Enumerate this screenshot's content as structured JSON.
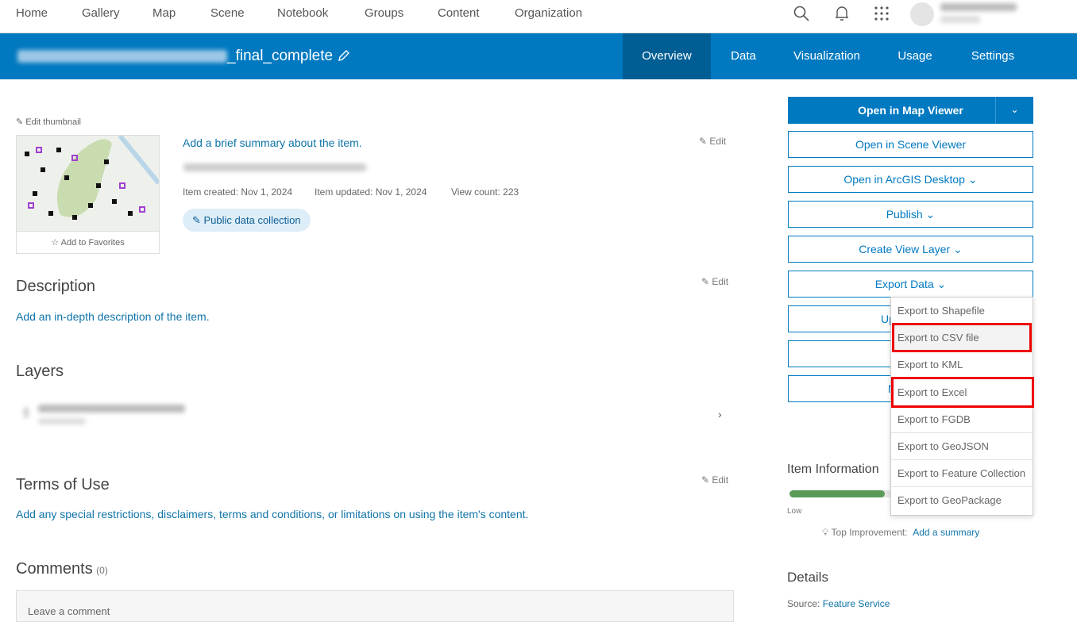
{
  "topnav": {
    "items": [
      "Home",
      "Gallery",
      "Map",
      "Scene",
      "Notebook",
      "Groups",
      "Content",
      "Organization"
    ]
  },
  "header": {
    "title_visible": "_final_complete",
    "tabs": [
      "Overview",
      "Data",
      "Visualization",
      "Usage",
      "Settings"
    ],
    "active_tab": "Overview"
  },
  "thumbnail": {
    "edit_label": "Edit thumbnail",
    "favorites_label": "Add to Favorites"
  },
  "summary": {
    "placeholder": "Add a brief summary about the item.",
    "edit": "Edit",
    "created": "Item created: Nov 1, 2024",
    "updated": "Item updated: Nov 1, 2024",
    "views": "View count: 223",
    "badge": "Public data collection"
  },
  "description": {
    "title": "Description",
    "edit": "Edit",
    "placeholder": "Add an in-depth description of the item."
  },
  "layers": {
    "title": "Layers"
  },
  "terms": {
    "title": "Terms of Use",
    "edit": "Edit",
    "placeholder": "Add any special restrictions, disclaimers, terms and conditions, or limitations on using the item's content."
  },
  "comments": {
    "title": "Comments",
    "count": "(0)",
    "placeholder": "Leave a comment"
  },
  "actions": {
    "open_map": "Open in Map Viewer",
    "open_scene": "Open in Scene Viewer",
    "open_desktop": "Open in ArcGIS Desktop",
    "publish": "Publish",
    "create_view": "Create View Layer",
    "export": "Export Data",
    "update_partial": "Up",
    "more_partial": "M"
  },
  "export_menu": {
    "items": [
      "Export to Shapefile",
      "Export to CSV file",
      "Export to KML",
      "Export to Excel",
      "Export to FGDB",
      "Export to GeoJSON",
      "Export to Feature Collection",
      "Export to GeoPackage"
    ],
    "highlighted": [
      "Export to CSV file",
      "Export to Excel"
    ]
  },
  "item_info": {
    "title": "Item Information",
    "level": "Low",
    "progress": 0.4,
    "top_improvement_label": "Top Improvement:",
    "top_improvement_link": "Add a summary"
  },
  "details": {
    "title": "Details",
    "source_label": "Source:",
    "source_value": "Feature Service"
  },
  "colors": {
    "brand": "#0079c1",
    "active_tab": "#005e95",
    "progress": "#5a9a58",
    "highlight": "#e00000"
  }
}
